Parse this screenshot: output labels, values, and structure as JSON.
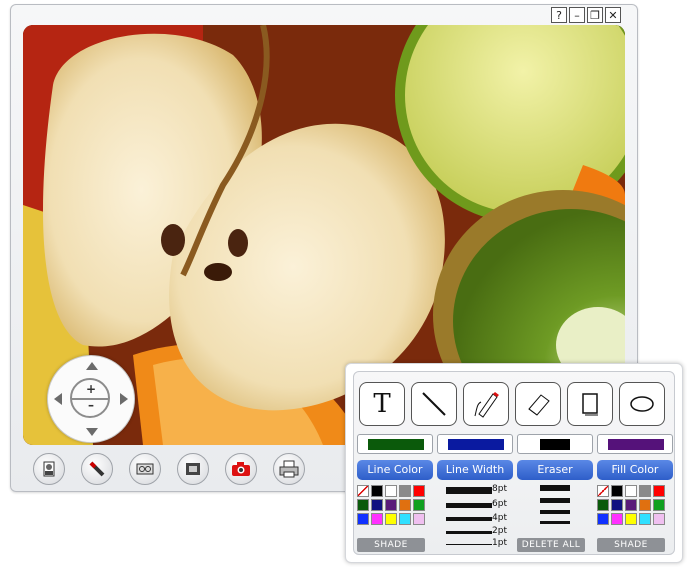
{
  "window": {
    "help_label": "?",
    "minimize_label": "–",
    "maximize_label": "❐",
    "close_label": "✕"
  },
  "ptz": {
    "zoom_in": "+",
    "zoom_out": "–"
  },
  "toolbar": {
    "buttons": [
      "user-icon",
      "pen-icon",
      "tape-icon",
      "film-icon",
      "camera-icon",
      "printer-icon"
    ]
  },
  "palette": {
    "tools": [
      "text-tool",
      "line-tool",
      "pen-tool",
      "eraser-tool",
      "rectangle-tool",
      "ellipse-tool"
    ],
    "text_tool_glyph": "T",
    "line_color_label": "Line Color",
    "line_width_label": "Line Width",
    "eraser_label": "Eraser",
    "fill_color_label": "Fill Color",
    "line_color_value": "#0b5a0b",
    "line_width_value": "#0a1aa0",
    "eraser_value": "#000000",
    "fill_color_value": "#55127a",
    "shade_label": "SHADE",
    "delete_all_label": "DELETE ALL",
    "widths": [
      {
        "label": "8pt"
      },
      {
        "label": "6pt"
      },
      {
        "label": "4pt"
      },
      {
        "label": "2pt"
      },
      {
        "label": "1pt"
      }
    ],
    "colors": [
      [
        "none",
        "#000000",
        "#ffffff",
        "#8a8a8a",
        "#ff0000"
      ],
      [
        "#0b5a0b",
        "#101080",
        "#5a1a7a",
        "#e07010",
        "#10a020"
      ],
      [
        "#1030ff",
        "#ff30ff",
        "#ffff00",
        "#30e0ff",
        "#f0c0f0"
      ]
    ]
  }
}
